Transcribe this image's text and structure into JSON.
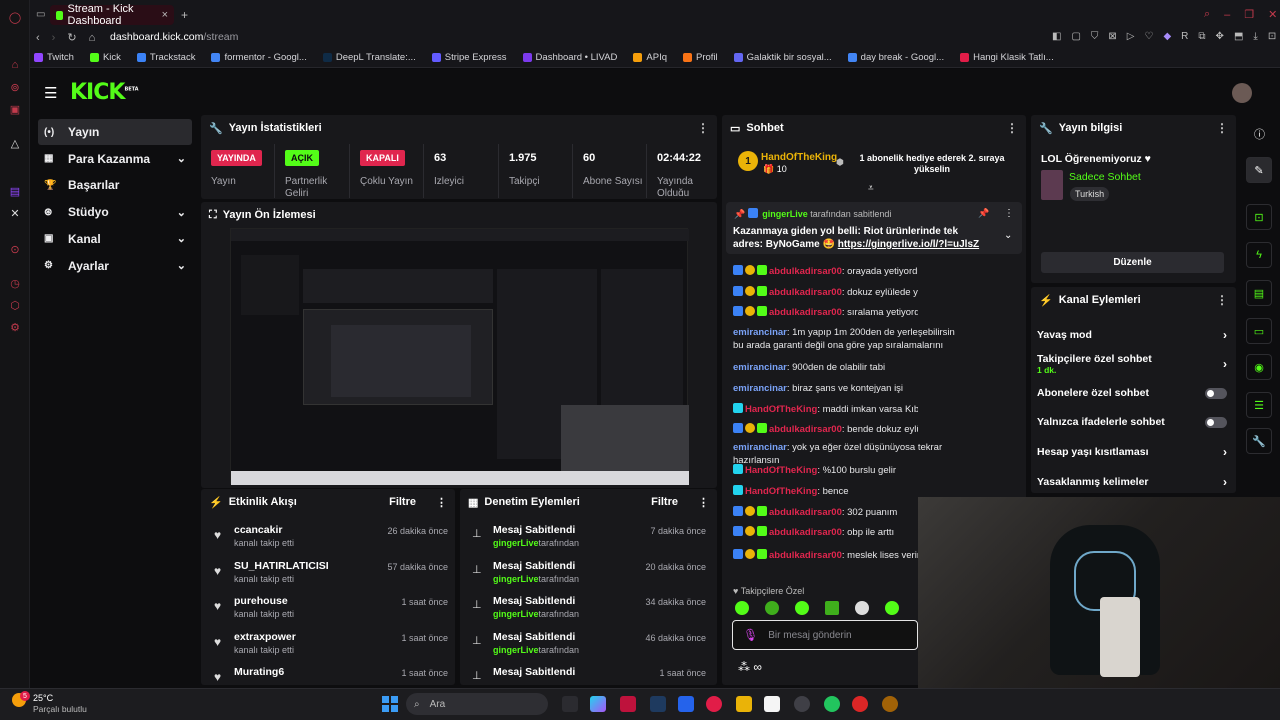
{
  "browser": {
    "tab_title": "Stream - Kick Dashboard",
    "new_tab": "+",
    "url_domain": "dashboard.kick.com",
    "url_path": "/stream",
    "bookmarks": [
      "Twitch",
      "Kick",
      "Trackstack",
      "formentor - Googl...",
      "DeepL Translate:...",
      "Stripe Express",
      "Dashboard • LIVAD",
      "APIq",
      "Profil",
      "Galaktik bir sosyal...",
      "day break - Googl...",
      "Hangi Klasik Tatlı..."
    ],
    "bookmark_colors": [
      "#9146ff",
      "#53fc18",
      "#3b82f6",
      "#4285f4",
      "#0f2b46",
      "#635bff",
      "#7c3aed",
      "#f59e0b",
      "#f97316",
      "#6366f1",
      "#4285f4",
      "#e11d48"
    ]
  },
  "logo": {
    "text": "KICK",
    "beta": "BETA"
  },
  "sidebar": [
    {
      "label": "Yayın",
      "icon": "broadcast-icon",
      "chevron": false,
      "active": true
    },
    {
      "label": "Para Kazanma",
      "icon": "money-icon",
      "chevron": true
    },
    {
      "label": "Başarılar",
      "icon": "trophy-icon",
      "chevron": false
    },
    {
      "label": "Stüdyo",
      "icon": "studio-icon",
      "chevron": true
    },
    {
      "label": "Kanal",
      "icon": "channel-icon",
      "chevron": true
    },
    {
      "label": "Ayarlar",
      "icon": "gear-icon",
      "chevron": true
    }
  ],
  "stats": {
    "title": "Yayın İstatistikleri",
    "items": [
      {
        "badge": "YAYINDA",
        "label": "Yayın",
        "color": "#e0264e"
      },
      {
        "badge": "AÇIK",
        "label": "Partnerlik Geliri",
        "color": "#53fc18"
      },
      {
        "badge": "KAPALI",
        "label": "Çoklu Yayın",
        "color": "#e0264e"
      },
      {
        "value": "63",
        "label": "İzleyici"
      },
      {
        "value": "1.975",
        "label": "Takipçi"
      },
      {
        "value": "60",
        "label": "Abone Sayısı"
      },
      {
        "value": "02:44:22",
        "label": "Yayında Olduğu"
      }
    ]
  },
  "preview": {
    "title": "Yayın Ön İzlemesi"
  },
  "activity": {
    "title": "Etkinlik Akışı",
    "filter": "Filtre",
    "items": [
      {
        "name": "ccancakir",
        "action": "kanalı takip etti",
        "time": "26 dakika önce"
      },
      {
        "name": "SU_HATIRLATICISI",
        "action": "kanalı takip etti",
        "time": "57 dakika önce"
      },
      {
        "name": "purehouse",
        "action": "kanalı takip etti",
        "time": "1 saat önce"
      },
      {
        "name": "extraxpower",
        "action": "kanalı takip etti",
        "time": "1 saat önce"
      },
      {
        "name": "Murating6",
        "action": "",
        "time": "1 saat önce"
      }
    ]
  },
  "moderation": {
    "title": "Denetim Eylemleri",
    "filter": "Filtre",
    "items": [
      {
        "title": "Mesaj Sabitlendi",
        "user": "gingerLive",
        "suffix": "tarafından",
        "time": "7 dakika önce"
      },
      {
        "title": "Mesaj Sabitlendi",
        "user": "gingerLive",
        "suffix": "tarafından",
        "time": "20 dakika önce"
      },
      {
        "title": "Mesaj Sabitlendi",
        "user": "gingerLive",
        "suffix": "tarafından",
        "time": "34 dakika önce"
      },
      {
        "title": "Mesaj Sabitlendi",
        "user": "gingerLive",
        "suffix": "tarafından",
        "time": "46 dakika önce"
      },
      {
        "title": "Mesaj Sabitlendi",
        "user": "",
        "suffix": "",
        "time": "1 saat önce"
      }
    ]
  },
  "chat": {
    "title": "Sohbet",
    "gifter_name": "HandOfTheKing",
    "gifter_count": "10",
    "gifter_rank": "1",
    "gift_text": "1 abonelik hediye ederek 2. sıraya yükselin",
    "pinned_by": "gingerLive",
    "pinned_suffix": "tarafından sabitlendi",
    "pinned_text": "Kazanmaya giden yol belli: Riot ürünlerinde tek adres: ByNoGame 🤩",
    "pinned_link": "https://gingerlive.io/l/?l=uJlsZ",
    "messages": [
      {
        "user": "abdulkadirsar00",
        "color": "#e0264e",
        "text": ": orayada yetiyordu",
        "badges": 3
      },
      {
        "user": "abdulkadirsar00",
        "color": "#e0264e",
        "text": ": dokuz eylülede yetiyordu",
        "badges": 3
      },
      {
        "user": "abdulkadirsar00",
        "color": "#e0264e",
        "text": ": sıralama yetiyordu",
        "badges": 3
      },
      {
        "user": "emirancinar",
        "color": "#7aa2f7",
        "text": ": 1m yapıp 1m 200den de yerleşebilirsin bu arada garanti değil ona göre yap sıralamalarını",
        "badges": 0
      },
      {
        "user": "emirancinar",
        "color": "#7aa2f7",
        "text": ": 900den de olabilir tabi",
        "badges": 0
      },
      {
        "user": "emirancinar",
        "color": "#7aa2f7",
        "text": ": biraz şans ve kontejyan işi",
        "badges": 0
      },
      {
        "user": "HandOfTheKing",
        "color": "#e0264e",
        "text": ": maddi imkan varsa Kıbrıs'a git",
        "badges": 1
      },
      {
        "user": "abdulkadirsar00",
        "color": "#e0264e",
        "text": ": bende dokuz eylül 329 diyor yeter",
        "badges": 3
      },
      {
        "user": "emirancinar",
        "color": "#7aa2f7",
        "text": ": yok ya eğer özel düşünüyosa tekrar hazırlansın",
        "badges": 0
      },
      {
        "user": "HandOfTheKing",
        "color": "#e0264e",
        "text": ": %100 burslu gelir",
        "badges": 1
      },
      {
        "user": "HandOfTheKing",
        "color": "#e0264e",
        "text": ": bence",
        "badges": 1
      },
      {
        "user": "abdulkadirsar00",
        "color": "#e0264e",
        "text": ": 302 puanım",
        "badges": 3
      },
      {
        "user": "abdulkadirsar00",
        "color": "#e0264e",
        "text": ": obp ile arttı",
        "badges": 3
      },
      {
        "user": "abdulkadirsar00",
        "color": "#e0264e",
        "text": ": meslek lises verirlerse girerim",
        "badges": 3
      }
    ],
    "emote_label": "Takipçilere Özel",
    "input_placeholder": "Bir mesaj gönderin"
  },
  "stream_info": {
    "title": "Yayın bilgisi",
    "stream_title": "LOL Öğrenemiyoruz ♥",
    "category": "Sadece Sohbet",
    "tag": "Turkish",
    "edit": "Düzenle"
  },
  "channel_actions": {
    "title": "Kanal Eylemleri",
    "items": [
      {
        "label": "Yavaş mod",
        "type": "arrow"
      },
      {
        "label": "Takipçilere özel sohbet",
        "sub": "1 dk.",
        "type": "arrow"
      },
      {
        "label": "Abonelere özel sohbet",
        "type": "toggle"
      },
      {
        "label": "Yalnızca ifadelerle sohbet",
        "type": "toggle"
      },
      {
        "label": "Hesap yaşı kısıtlaması",
        "type": "arrow"
      },
      {
        "label": "Yasaklanmış kelimeler",
        "type": "arrow"
      }
    ]
  },
  "taskbar": {
    "temp": "25°C",
    "weather": "Parçalı bulutlu",
    "search": "Ara",
    "badge": "5"
  }
}
